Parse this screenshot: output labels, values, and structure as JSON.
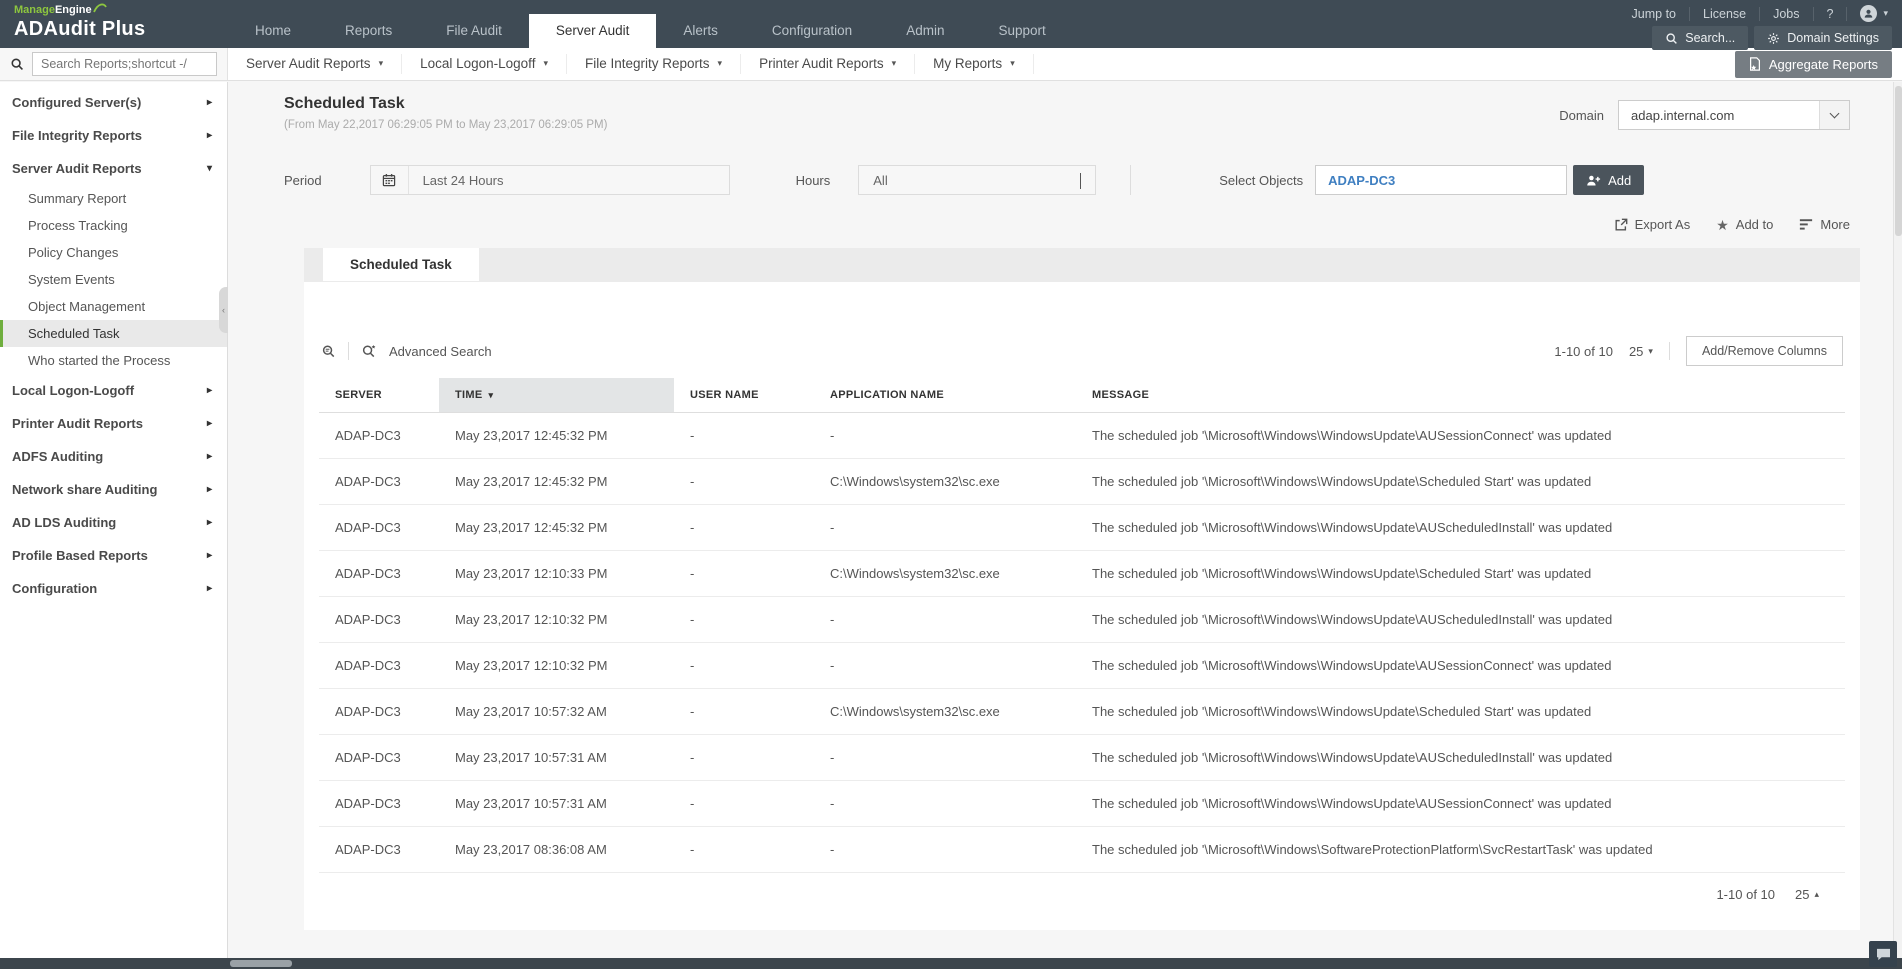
{
  "header": {
    "brand": {
      "manage": "Manage",
      "engine": "Engine",
      "product": "ADAudit Plus"
    },
    "nav": [
      {
        "label": "Home"
      },
      {
        "label": "Reports"
      },
      {
        "label": "File Audit"
      },
      {
        "label": "Server Audit",
        "active": true
      },
      {
        "label": "Alerts"
      },
      {
        "label": "Configuration"
      },
      {
        "label": "Admin"
      },
      {
        "label": "Support"
      }
    ],
    "utilities": [
      "Jump to",
      "License",
      "Jobs",
      "?"
    ],
    "search_button": "Search...",
    "domain_settings_button": "Domain Settings"
  },
  "subbar": {
    "search_placeholder": "Search Reports;shortcut -/",
    "menus": [
      "Server Audit Reports",
      "Local Logon-Logoff",
      "File Integrity Reports",
      "Printer Audit Reports",
      "My Reports"
    ],
    "aggregate_button": "Aggregate Reports"
  },
  "sidebar": {
    "items": [
      {
        "label": "Configured Server(s)",
        "state": "collapsed"
      },
      {
        "label": "File Integrity Reports",
        "state": "collapsed"
      },
      {
        "label": "Server Audit Reports",
        "state": "expanded",
        "children": [
          {
            "label": "Summary Report"
          },
          {
            "label": "Process Tracking"
          },
          {
            "label": "Policy Changes"
          },
          {
            "label": "System Events"
          },
          {
            "label": "Object Management"
          },
          {
            "label": "Scheduled Task",
            "active": true
          },
          {
            "label": "Who started the Process"
          }
        ]
      },
      {
        "label": "Local Logon-Logoff",
        "state": "collapsed"
      },
      {
        "label": "Printer Audit Reports",
        "state": "collapsed"
      },
      {
        "label": "ADFS Auditing",
        "state": "collapsed"
      },
      {
        "label": "Network share Auditing",
        "state": "collapsed"
      },
      {
        "label": "AD LDS Auditing",
        "state": "collapsed"
      },
      {
        "label": "Profile Based Reports",
        "state": "collapsed"
      },
      {
        "label": "Configuration",
        "state": "collapsed"
      }
    ]
  },
  "main": {
    "title": "Scheduled Task",
    "subtitle": "(From May 22,2017 06:29:05 PM to May 23,2017 06:29:05 PM)",
    "domain": {
      "label": "Domain",
      "value": "adap.internal.com"
    },
    "filters": {
      "period_label": "Period",
      "period_value": "Last 24 Hours",
      "hours_label": "Hours",
      "hours_value": "All",
      "select_objects_label": "Select Objects",
      "select_objects_value": "ADAP-DC3",
      "add_button": "Add"
    },
    "actions": {
      "export_as": "Export As",
      "add_to": "Add to",
      "more": "More"
    },
    "tab": "Scheduled Task",
    "toolbar": {
      "advanced_search": "Advanced Search",
      "range": "1-10 of 10",
      "page_size": "25",
      "add_remove_columns": "Add/Remove Columns"
    },
    "footer": {
      "range": "1-10 of 10",
      "page_size": "25"
    }
  },
  "table": {
    "columns": [
      {
        "label": "SERVER"
      },
      {
        "label": "TIME",
        "sorted": true
      },
      {
        "label": "USER NAME"
      },
      {
        "label": "APPLICATION NAME"
      },
      {
        "label": "MESSAGE"
      }
    ],
    "rows": [
      {
        "server": "ADAP-DC3",
        "time": "May 23,2017 12:45:32 PM",
        "user": "-",
        "app": "-",
        "message": "The scheduled job '\\Microsoft\\Windows\\WindowsUpdate\\AUSessionConnect' was updated"
      },
      {
        "server": "ADAP-DC3",
        "time": "May 23,2017 12:45:32 PM",
        "user": "-",
        "app": "C:\\Windows\\system32\\sc.exe",
        "message": "The scheduled job '\\Microsoft\\Windows\\WindowsUpdate\\Scheduled Start' was updated"
      },
      {
        "server": "ADAP-DC3",
        "time": "May 23,2017 12:45:32 PM",
        "user": "-",
        "app": "-",
        "message": "The scheduled job '\\Microsoft\\Windows\\WindowsUpdate\\AUScheduledInstall' was updated"
      },
      {
        "server": "ADAP-DC3",
        "time": "May 23,2017 12:10:33 PM",
        "user": "-",
        "app": "C:\\Windows\\system32\\sc.exe",
        "message": "The scheduled job '\\Microsoft\\Windows\\WindowsUpdate\\Scheduled Start' was updated"
      },
      {
        "server": "ADAP-DC3",
        "time": "May 23,2017 12:10:32 PM",
        "user": "-",
        "app": "-",
        "message": "The scheduled job '\\Microsoft\\Windows\\WindowsUpdate\\AUScheduledInstall' was updated"
      },
      {
        "server": "ADAP-DC3",
        "time": "May 23,2017 12:10:32 PM",
        "user": "-",
        "app": "-",
        "message": "The scheduled job '\\Microsoft\\Windows\\WindowsUpdate\\AUSessionConnect' was updated"
      },
      {
        "server": "ADAP-DC3",
        "time": "May 23,2017 10:57:32 AM",
        "user": "-",
        "app": "C:\\Windows\\system32\\sc.exe",
        "message": "The scheduled job '\\Microsoft\\Windows\\WindowsUpdate\\Scheduled Start' was updated"
      },
      {
        "server": "ADAP-DC3",
        "time": "May 23,2017 10:57:31 AM",
        "user": "-",
        "app": "-",
        "message": "The scheduled job '\\Microsoft\\Windows\\WindowsUpdate\\AUScheduledInstall' was updated"
      },
      {
        "server": "ADAP-DC3",
        "time": "May 23,2017 10:57:31 AM",
        "user": "-",
        "app": "-",
        "message": "The scheduled job '\\Microsoft\\Windows\\WindowsUpdate\\AUSessionConnect' was updated"
      },
      {
        "server": "ADAP-DC3",
        "time": "May 23,2017 08:36:08 AM",
        "user": "-",
        "app": "-",
        "message": "The scheduled job '\\Microsoft\\Windows\\SoftwareProtectionPlatform\\SvcRestartTask' was updated"
      }
    ]
  },
  "colors": {
    "header_bg": "#3f4b55",
    "brand_green": "#8dc63f",
    "active_item_green": "#6fae3e",
    "object_link_blue": "#3f7fc1",
    "dark_button": "#4b545c",
    "sorted_column_bg": "#e3e5e6"
  },
  "icons": {
    "caret_down": "▾",
    "caret_right": "▸",
    "caret_up": "▴",
    "star": "★",
    "collapse_arrow": "‹"
  }
}
